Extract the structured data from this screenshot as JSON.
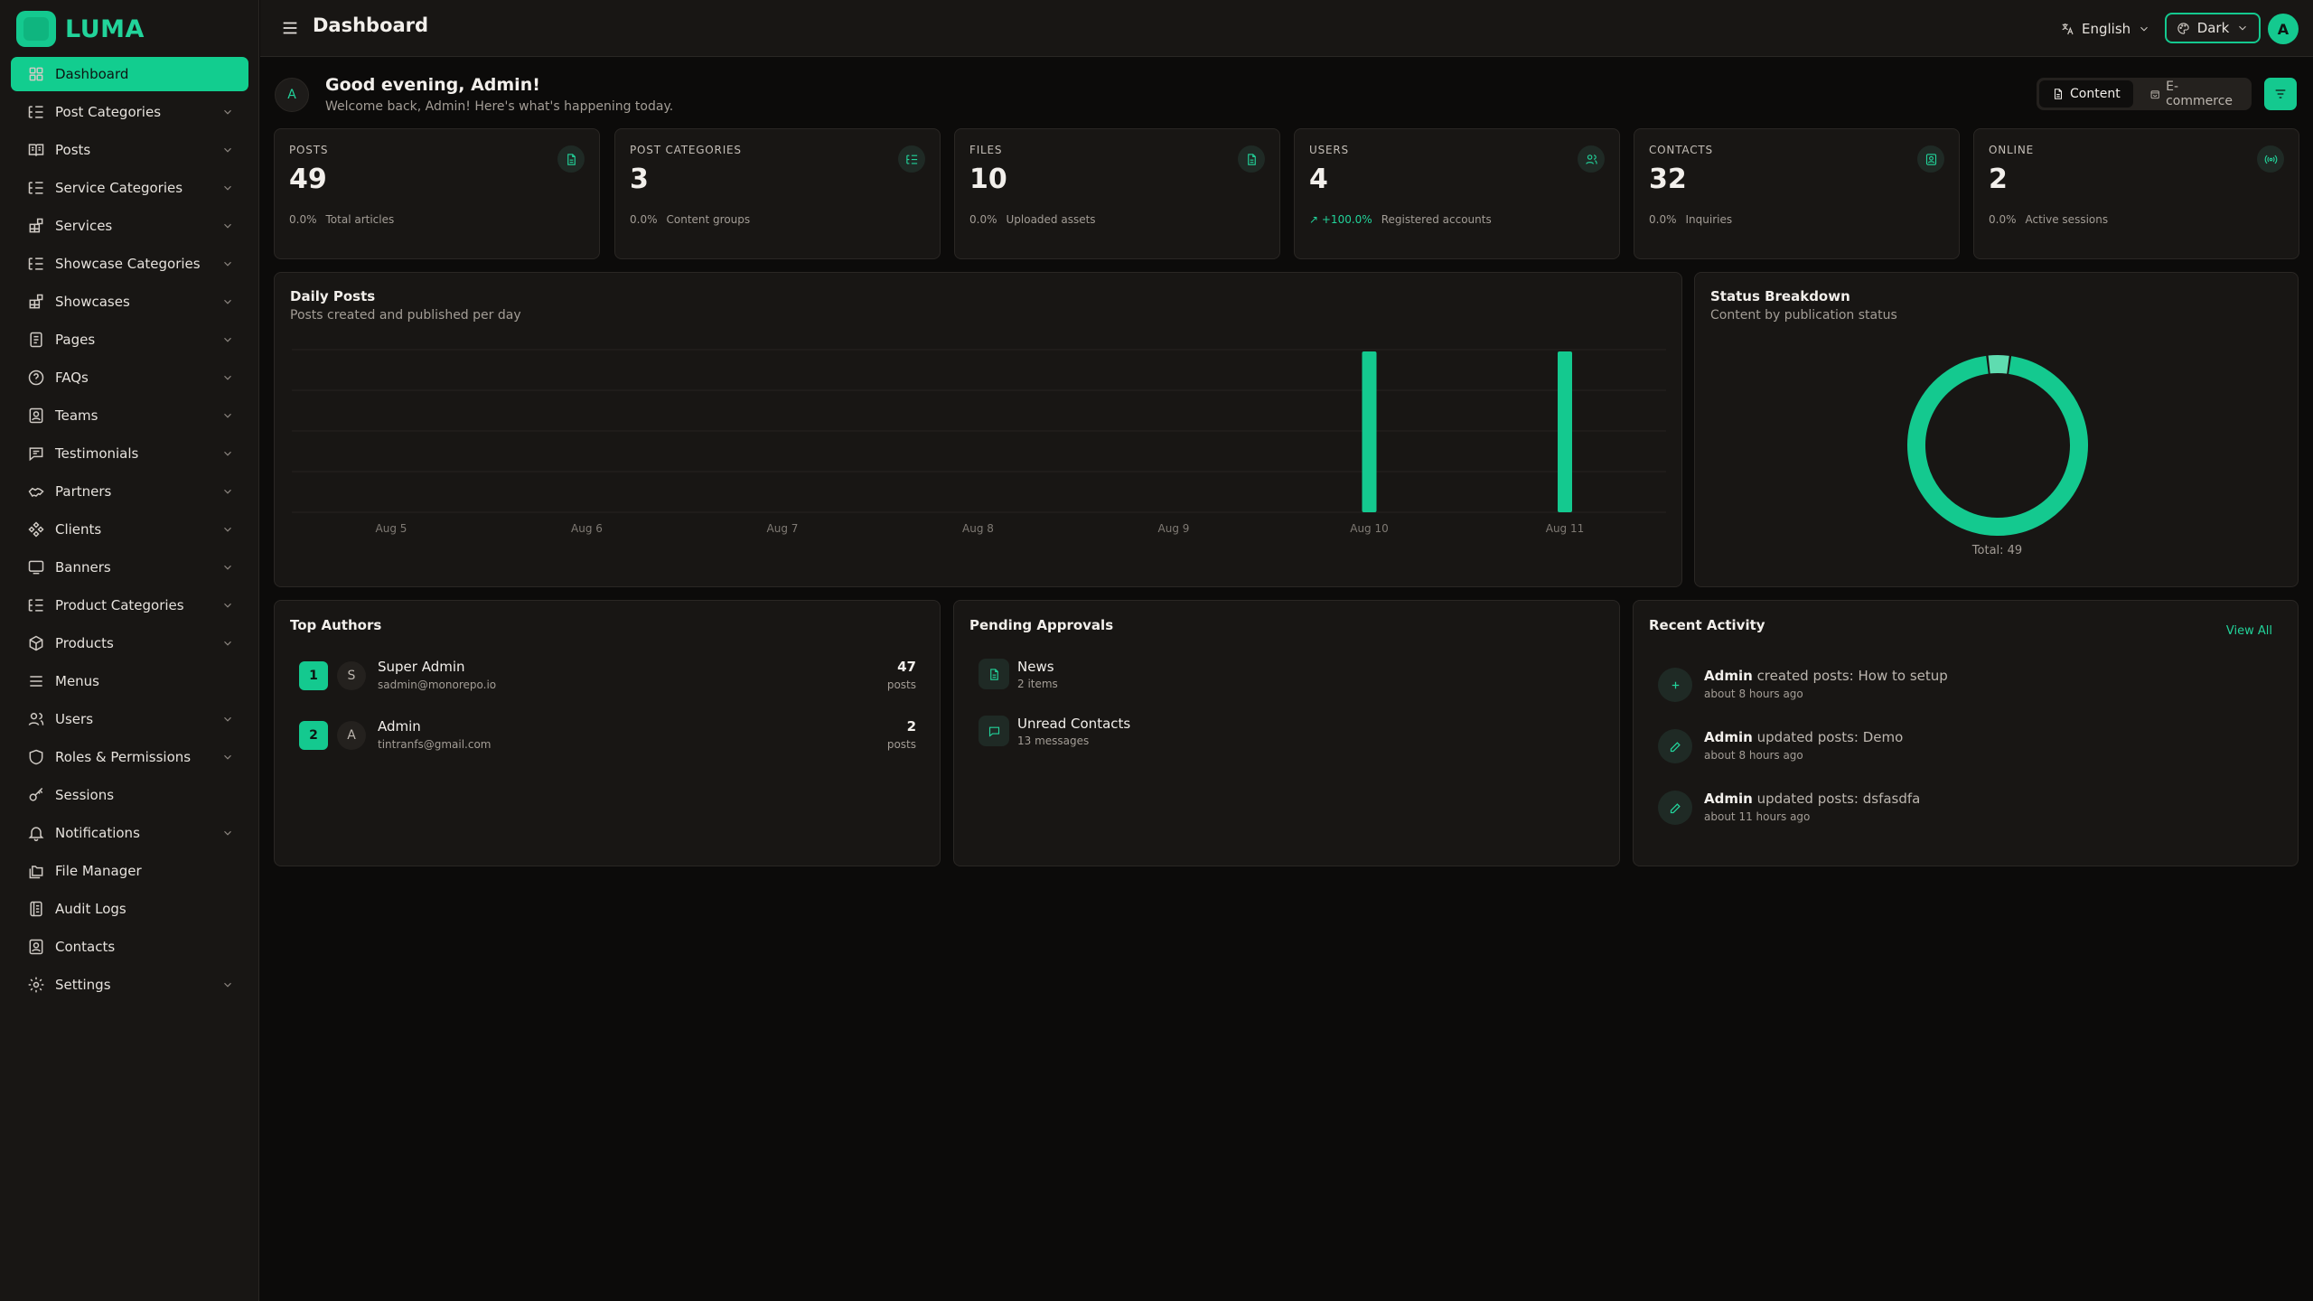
{
  "brand": {
    "name": "LUMA"
  },
  "sidebar": {
    "items": [
      {
        "label": "Dashboard",
        "icon": "dashboard-icon",
        "active": true,
        "expandable": false
      },
      {
        "label": "Post Categories",
        "icon": "list-tree-icon",
        "expandable": true
      },
      {
        "label": "Posts",
        "icon": "book-icon",
        "expandable": true
      },
      {
        "label": "Service Categories",
        "icon": "list-tree-icon",
        "expandable": true
      },
      {
        "label": "Services",
        "icon": "blocks-icon",
        "expandable": true
      },
      {
        "label": "Showcase Categories",
        "icon": "list-tree-icon",
        "expandable": true
      },
      {
        "label": "Showcases",
        "icon": "blocks-icon",
        "expandable": true
      },
      {
        "label": "Pages",
        "icon": "page-icon",
        "expandable": true
      },
      {
        "label": "FAQs",
        "icon": "help-circle-icon",
        "expandable": true
      },
      {
        "label": "Teams",
        "icon": "contact-card-icon",
        "expandable": true
      },
      {
        "label": "Testimonials",
        "icon": "message-icon",
        "expandable": true
      },
      {
        "label": "Partners",
        "icon": "handshake-icon",
        "expandable": true
      },
      {
        "label": "Clients",
        "icon": "diamond-grid-icon",
        "expandable": true
      },
      {
        "label": "Banners",
        "icon": "monitor-icon",
        "expandable": true
      },
      {
        "label": "Product Categories",
        "icon": "list-tree-icon",
        "expandable": true
      },
      {
        "label": "Products",
        "icon": "package-icon",
        "expandable": true
      },
      {
        "label": "Menus",
        "icon": "menu-icon",
        "expandable": false
      },
      {
        "label": "Users",
        "icon": "users-icon",
        "expandable": true
      },
      {
        "label": "Roles & Permissions",
        "icon": "shield-icon",
        "expandable": true
      },
      {
        "label": "Sessions",
        "icon": "key-icon",
        "expandable": false
      },
      {
        "label": "Notifications",
        "icon": "bell-icon",
        "expandable": true
      },
      {
        "label": "File Manager",
        "icon": "folders-icon",
        "expandable": false
      },
      {
        "label": "Audit Logs",
        "icon": "logs-icon",
        "expandable": false
      },
      {
        "label": "Contacts",
        "icon": "contact-card-icon",
        "expandable": false
      },
      {
        "label": "Settings",
        "icon": "gear-icon",
        "expandable": true
      }
    ]
  },
  "header": {
    "title": "Dashboard",
    "language": "English",
    "theme": "Dark",
    "avatar_initial": "A"
  },
  "greeting": {
    "avatar_initial": "A",
    "title": "Good evening, Admin!",
    "subtitle": "Welcome back, Admin! Here's what's happening today.",
    "tabs": [
      {
        "label": "Content",
        "active": true
      },
      {
        "label": "E-commerce",
        "active": false
      }
    ]
  },
  "stats": [
    {
      "label": "POSTS",
      "value": "49",
      "delta": "0.0%",
      "desc": "Total articles",
      "up": false,
      "icon": "document-icon"
    },
    {
      "label": "POST CATEGORIES",
      "value": "3",
      "delta": "0.0%",
      "desc": "Content groups",
      "up": false,
      "icon": "list-tree-icon"
    },
    {
      "label": "FILES",
      "value": "10",
      "delta": "0.0%",
      "desc": "Uploaded assets",
      "up": false,
      "icon": "document-icon"
    },
    {
      "label": "USERS",
      "value": "4",
      "delta": "+100.0%",
      "desc": "Registered accounts",
      "up": true,
      "icon": "users-icon"
    },
    {
      "label": "CONTACTS",
      "value": "32",
      "delta": "0.0%",
      "desc": "Inquiries",
      "up": false,
      "icon": "contact-card-icon"
    },
    {
      "label": "ONLINE",
      "value": "2",
      "delta": "0.0%",
      "desc": "Active sessions",
      "up": false,
      "icon": "radio-icon"
    }
  ],
  "daily_posts": {
    "title": "Daily Posts",
    "subtitle": "Posts created and published per day"
  },
  "status_breakdown": {
    "title": "Status Breakdown",
    "subtitle": "Content by publication status",
    "total_label": "Total: 49"
  },
  "chart_data": [
    {
      "type": "bar",
      "title": "Daily Posts",
      "categories": [
        "Aug 5",
        "Aug 6",
        "Aug 7",
        "Aug 8",
        "Aug 9",
        "Aug 10",
        "Aug 11"
      ],
      "values": [
        0,
        0,
        0,
        0,
        0,
        1,
        1
      ],
      "ylim": [
        0,
        1
      ],
      "grid": true,
      "color": "#14c98f"
    },
    {
      "type": "pie",
      "title": "Status Breakdown",
      "values": [
        47,
        2
      ],
      "colors": [
        "#14c98f",
        "#5fdcb0"
      ],
      "total": 49
    }
  ],
  "top_authors": {
    "title": "Top Authors",
    "items": [
      {
        "rank": "1",
        "initial": "S",
        "name": "Super Admin",
        "email": "sadmin@monorepo.io",
        "count": "47",
        "unit": "posts"
      },
      {
        "rank": "2",
        "initial": "A",
        "name": "Admin",
        "email": "tintranfs@gmail.com",
        "count": "2",
        "unit": "posts"
      }
    ]
  },
  "pending": {
    "title": "Pending Approvals",
    "items": [
      {
        "title": "News",
        "sub": "2 items",
        "icon": "document-icon"
      },
      {
        "title": "Unread Contacts",
        "sub": "13 messages",
        "icon": "message-icon"
      }
    ]
  },
  "activity": {
    "title": "Recent Activity",
    "view_all": "View All",
    "items": [
      {
        "actor": "Admin",
        "text": " created posts: How to setup",
        "time": "about 8 hours ago",
        "icon": "plus-icon"
      },
      {
        "actor": "Admin",
        "text": " updated posts: Demo",
        "time": "about 8 hours ago",
        "icon": "pencil-icon"
      },
      {
        "actor": "Admin",
        "text": " updated posts: dsfasdfa",
        "time": "about 11 hours ago",
        "icon": "pencil-icon"
      }
    ]
  },
  "colors": {
    "accent": "#14c98f",
    "background": "#0c0b0a",
    "card": "#181614"
  }
}
